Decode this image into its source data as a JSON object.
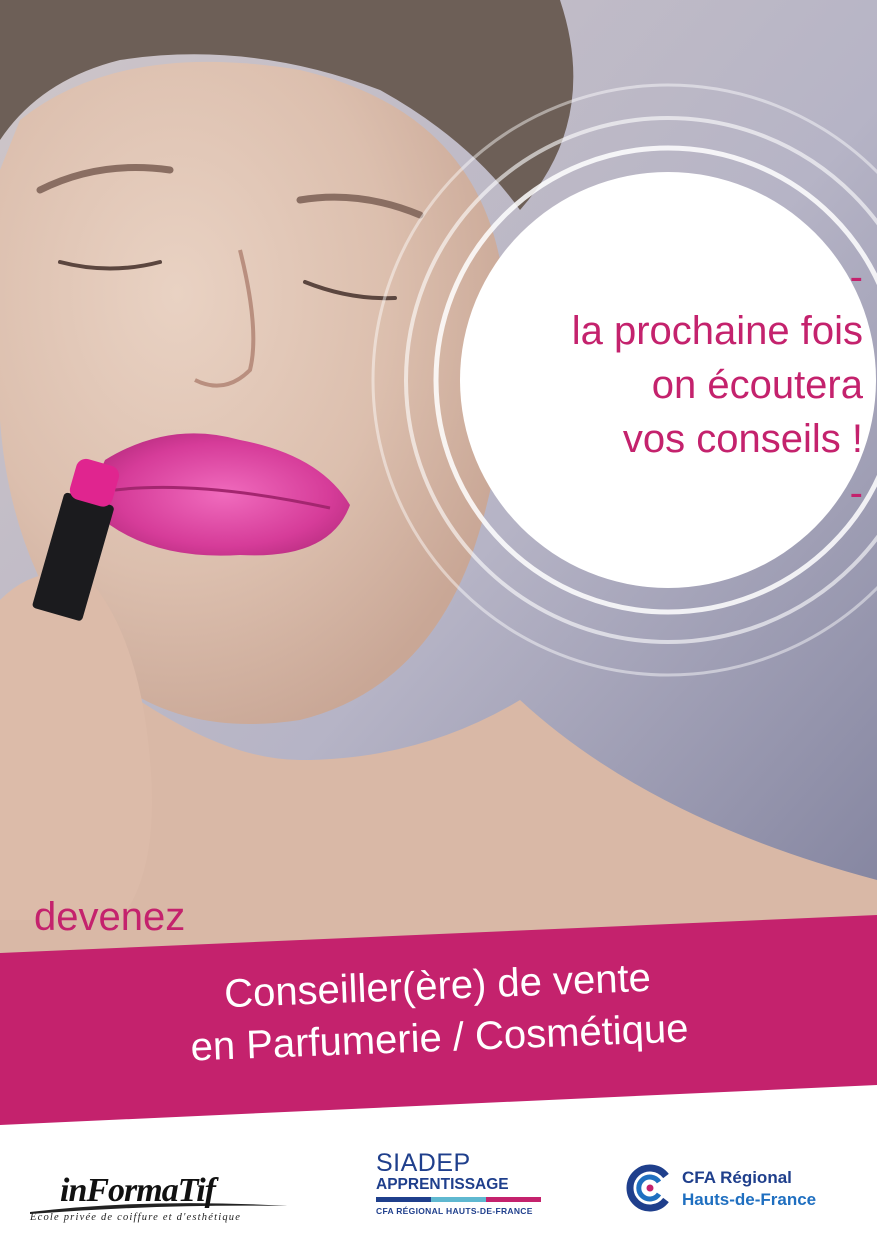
{
  "colors": {
    "accent": "#c4226d",
    "navy": "#1f3f8c",
    "blue": "#1f6fc0",
    "white": "#ffffff"
  },
  "bubble": {
    "dash_top": "-",
    "line1": "la prochaine fois",
    "line2": "on écoutera",
    "line3": "vos conseils !",
    "dash_bottom": "-"
  },
  "devenez": "devenez",
  "banner": {
    "line1": "Conseiller(ère) de vente",
    "line2": "en Parfumerie / Cosmétique"
  },
  "logos": {
    "informatif": {
      "name": "inFormaTif",
      "tagline": "Ecole privée de coiffure et d'esthétique"
    },
    "siadep": {
      "name": "SIADEP",
      "sub": "APPRENTISSAGE",
      "small": "CFA RÉGIONAL HAUTS-DE-FRANCE"
    },
    "cfa": {
      "line1": "CFA Régional",
      "line2": "Hauts-de-France",
      "icon": "cfa-c-logo-icon"
    }
  }
}
